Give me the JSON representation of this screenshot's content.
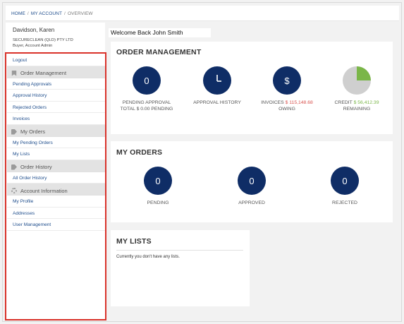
{
  "breadcrumb": {
    "home": "HOME",
    "account": "MY ACCOUNT",
    "current": "OVERVIEW",
    "separator": "/"
  },
  "user": {
    "name": "Davidson, Karen",
    "company": "SECURECLEAN (QLD) PTY LTD",
    "role": "Buyer, Account Admin"
  },
  "sidebar": {
    "logout": "Logout",
    "order_management": {
      "heading": "Order Management",
      "icon": "bookmark-icon",
      "items": [
        "Pending Approvals",
        "Approval History",
        "Rejected Orders",
        "Invoices"
      ]
    },
    "my_orders": {
      "heading": "My Orders",
      "icon": "tag-icon",
      "items": [
        "My Pending Orders",
        "My Lists"
      ]
    },
    "order_history": {
      "heading": "Order History",
      "icon": "tag-icon",
      "items": [
        "All Order History"
      ]
    },
    "account_information": {
      "heading": "Account Information",
      "icon": "gear-icon",
      "items": [
        "My Profile",
        "Addresses",
        "User Management"
      ]
    }
  },
  "welcome": "Welcome Back John Smith",
  "order_management": {
    "title": "ORDER MANAGEMENT",
    "pending_value": "0",
    "pending_label": "PENDING APPROVAL",
    "pending_total": "TOTAL $ 0.00 PENDING",
    "approval_label": "APPROVAL HISTORY",
    "approval_icon": "clock-icon",
    "invoices_label": "INVOICES",
    "invoices_amount": "$ 115,148.68",
    "invoices_owing": "OWING",
    "invoices_icon": "dollar-icon",
    "dollar_symbol": "$",
    "credit_label": "CREDIT",
    "credit_amount": "$ 56,412.39",
    "credit_remaining": "REMAINING",
    "credit_used_fraction": 0.75
  },
  "my_orders": {
    "title": "MY ORDERS",
    "pending_value": "0",
    "pending_label": "PENDING",
    "approved_value": "0",
    "approved_label": "APPROVED",
    "rejected_value": "0",
    "rejected_label": "REJECTED"
  },
  "my_lists": {
    "title": "MY LISTS",
    "empty_text": "Currently you don't have any lists."
  },
  "colors": {
    "accent_navy": "#0f2d66",
    "link_blue": "#1e4d8c",
    "owing_red": "#d9534f",
    "credit_green": "#7ab648",
    "highlight_red": "#d9322a"
  }
}
